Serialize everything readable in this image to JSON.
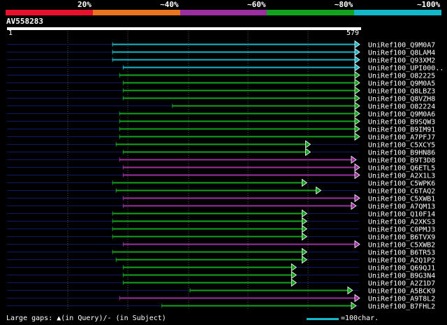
{
  "legend": {
    "segments": [
      {
        "color": "#e8102a",
        "label": "20%"
      },
      {
        "color": "#e8751f",
        "label": "~40%"
      },
      {
        "color": "#9c2fa0",
        "label": "~60%"
      },
      {
        "color": "#12a31e",
        "label": "~80%"
      },
      {
        "color": "#13b8c8",
        "label": "~100%"
      }
    ]
  },
  "query": {
    "name": "AV558283",
    "start": "1",
    "end": "579"
  },
  "footer": {
    "gaps_text": "Large gaps: ▲(in Query)/- (in Subject)",
    "scale_text": "=100char."
  },
  "hits": [
    {
      "name": "UniRef100_Q9M0A7",
      "color": "cyan",
      "start": 0.3,
      "end": 1.0
    },
    {
      "name": "UniRef100_Q8LAM4",
      "color": "cyan",
      "start": 0.3,
      "end": 1.0
    },
    {
      "name": "UniRef100_Q93XM2",
      "color": "cyan",
      "start": 0.3,
      "end": 1.0
    },
    {
      "name": "UniRef100_UPI000..",
      "color": "cyan",
      "start": 0.33,
      "end": 1.0
    },
    {
      "name": "UniRef100_O82225",
      "color": "green",
      "start": 0.32,
      "end": 1.0
    },
    {
      "name": "UniRef100_Q9M0A5",
      "color": "green",
      "start": 0.33,
      "end": 1.0
    },
    {
      "name": "UniRef100_Q8LBZ3",
      "color": "green",
      "start": 0.33,
      "end": 1.0
    },
    {
      "name": "UniRef100_Q8VZH8",
      "color": "green",
      "start": 0.33,
      "end": 1.0
    },
    {
      "name": "UniRef100_O82224",
      "color": "green",
      "start": 0.47,
      "end": 1.0
    },
    {
      "name": "UniRef100_Q9M0A6",
      "color": "green",
      "start": 0.32,
      "end": 1.0
    },
    {
      "name": "UniRef100_B9SQW3",
      "color": "green",
      "start": 0.32,
      "end": 1.0
    },
    {
      "name": "UniRef100_B9IM91",
      "color": "green",
      "start": 0.32,
      "end": 1.0
    },
    {
      "name": "UniRef100_A7PFJ7",
      "color": "green",
      "start": 0.32,
      "end": 1.0
    },
    {
      "name": "UniRef100_C5XCY5",
      "color": "green",
      "start": 0.31,
      "end": 0.86
    },
    {
      "name": "UniRef100_B9HN86",
      "color": "green",
      "start": 0.33,
      "end": 0.86
    },
    {
      "name": "UniRef100_B9T3D8",
      "color": "purple",
      "start": 0.32,
      "end": 0.99
    },
    {
      "name": "UniRef100_Q6ETL5",
      "color": "purple",
      "start": 0.33,
      "end": 1.0
    },
    {
      "name": "UniRef100_A2X1L3",
      "color": "purple",
      "start": 0.33,
      "end": 1.0
    },
    {
      "name": "UniRef100_C5WPK6",
      "color": "green",
      "start": 0.3,
      "end": 0.85
    },
    {
      "name": "UniRef100_C6TAQ2",
      "color": "green",
      "start": 0.31,
      "end": 0.89
    },
    {
      "name": "UniRef100_C5XWB1",
      "color": "purple",
      "start": 0.33,
      "end": 1.0
    },
    {
      "name": "UniRef100_A7QM13",
      "color": "purple",
      "start": 0.33,
      "end": 0.99
    },
    {
      "name": "UniRef100_Q10F14",
      "color": "green",
      "start": 0.3,
      "end": 0.85
    },
    {
      "name": "UniRef100_A2XKS3",
      "color": "green",
      "start": 0.3,
      "end": 0.85
    },
    {
      "name": "UniRef100_C0PMJ3",
      "color": "green",
      "start": 0.3,
      "end": 0.85
    },
    {
      "name": "UniRef100_B6TVX9",
      "color": "green",
      "start": 0.3,
      "end": 0.85
    },
    {
      "name": "UniRef100_C5XWB2",
      "color": "purple",
      "start": 0.33,
      "end": 1.0
    },
    {
      "name": "UniRef100_B6TR53",
      "color": "green",
      "start": 0.3,
      "end": 0.85
    },
    {
      "name": "UniRef100_A2Q1P2",
      "color": "green",
      "start": 0.31,
      "end": 0.85
    },
    {
      "name": "UniRef100_Q69QJ1",
      "color": "green",
      "start": 0.33,
      "end": 0.82
    },
    {
      "name": "UniRef100_B9G3N4",
      "color": "green",
      "start": 0.33,
      "end": 0.82
    },
    {
      "name": "UniRef100_A2Z1D7",
      "color": "green",
      "start": 0.33,
      "end": 0.82
    },
    {
      "name": "UniRef100_A5BCK9",
      "color": "green",
      "start": 0.52,
      "end": 0.98
    },
    {
      "name": "UniRef100_A9T8L2",
      "color": "purple",
      "start": 0.32,
      "end": 1.0
    },
    {
      "name": "UniRef100_B7FHL2",
      "color": "green",
      "start": 0.44,
      "end": 0.99
    }
  ],
  "colors": {
    "cyan": "#13b8c8",
    "green": "#12a31e",
    "purple": "#9c2fa0",
    "query": "#0a1a6a"
  }
}
